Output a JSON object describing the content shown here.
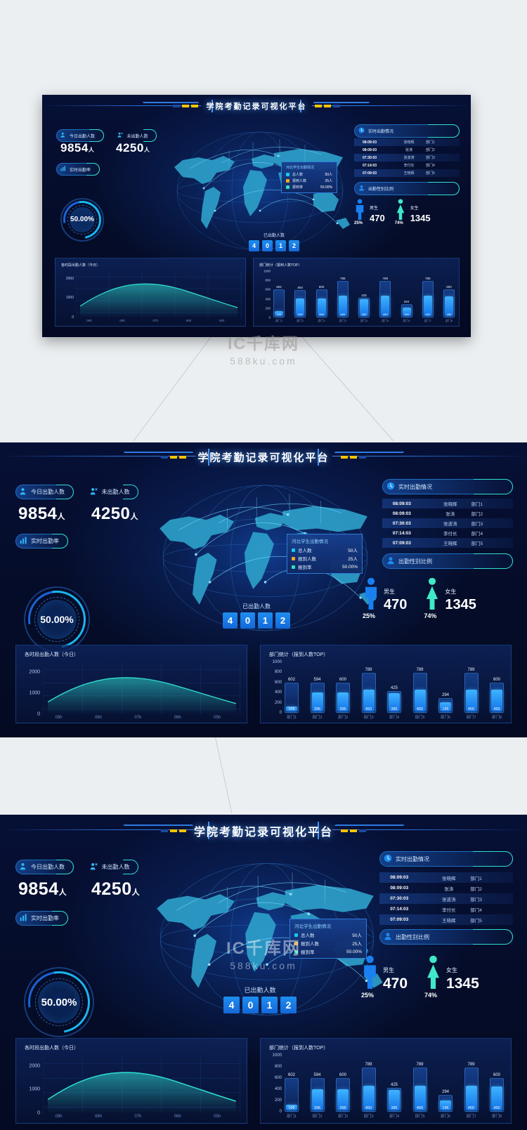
{
  "header": {
    "title": "学院考勤记录可视化平台"
  },
  "stats": {
    "present": {
      "label": "今日出勤人数",
      "value": "9854",
      "unit": "人",
      "icon": "user-check-icon"
    },
    "absent": {
      "label": "未出勤人数",
      "value": "4250",
      "unit": "人",
      "icon": "user-x-icon"
    },
    "rate": {
      "label": "实时出勤率",
      "value": "50.00%",
      "icon": "bar-chart-icon"
    }
  },
  "map": {
    "counter_label": "已出勤人数",
    "counter_digits": [
      "4",
      "0",
      "1",
      "2"
    ],
    "tooltip": {
      "title": "河北学生出勤情况",
      "rows": [
        {
          "color": "#19c8f0",
          "key": "总人数",
          "value": "50人"
        },
        {
          "color": "#f5a623",
          "key": "报到人数",
          "value": "25人"
        },
        {
          "color": "#2fe0c0",
          "key": "报到率",
          "value": "50.00%"
        }
      ]
    }
  },
  "realtime": {
    "panel_label": "实时出勤情况",
    "panel_icon": "clock-icon",
    "rows": [
      {
        "time": "08:09:03",
        "name": "张晓辉",
        "dept": "部门1"
      },
      {
        "time": "08:09:03",
        "name": "张涛",
        "dept": "部门2"
      },
      {
        "time": "07:30:03",
        "name": "张波涛",
        "dept": "部门3"
      },
      {
        "time": "07:14:03",
        "name": "李付长",
        "dept": "部门4"
      },
      {
        "time": "07:09:03",
        "name": "王晓辉",
        "dept": "部门5"
      }
    ]
  },
  "gender": {
    "panel_label": "出勤性别比例",
    "panel_icon": "user-icon",
    "male": {
      "label": "男生",
      "value": "470",
      "unit": "人",
      "percent": "25%",
      "color": "#1a7ff0",
      "icon": "male-icon"
    },
    "female": {
      "label": "女生",
      "value": "1345",
      "unit": "人",
      "percent": "74%",
      "color": "#3fe8c8",
      "icon": "female-icon"
    }
  },
  "watermark": {
    "line1": "IC千库网",
    "line2": "588ku.com"
  },
  "chart_data": [
    {
      "type": "line",
      "title": "各时段出勤人数（今日）",
      "xlabel": "",
      "ylabel": "",
      "categories": [
        "09h",
        "08h",
        "07h",
        "06h",
        "05h"
      ],
      "x": [
        0,
        10,
        20,
        30,
        40,
        50,
        60,
        70,
        80,
        90,
        100
      ],
      "values": [
        600,
        1180,
        1560,
        1760,
        1830,
        1810,
        1700,
        1540,
        1330,
        1080,
        790
      ],
      "ylim": [
        0,
        2400
      ],
      "yticks": [
        0,
        1000,
        2000
      ],
      "grid": true,
      "line_color": "#2fe0d0",
      "legend": ""
    },
    {
      "type": "bar",
      "title": "部门统计（报到人数TOP）",
      "xlabel": "",
      "ylabel": "",
      "categories": [
        "部门1",
        "部门2",
        "部门3",
        "部门3",
        "部门4",
        "部门5",
        "部门6",
        "部门7",
        "部门8"
      ],
      "series": [
        {
          "name": "总人数",
          "values": [
            602,
            594,
            600,
            789,
            425,
            789,
            294,
            789,
            600
          ]
        },
        {
          "name": "报到人数",
          "values": [
            105,
            396,
            396,
            450,
            385,
            450,
            195,
            450,
            450
          ]
        }
      ],
      "ylim": [
        0,
        1000
      ],
      "yticks": [
        0,
        200,
        400,
        600,
        800,
        1000
      ],
      "grid": true,
      "bar_color": "#2f9bf5",
      "legend": ""
    }
  ]
}
